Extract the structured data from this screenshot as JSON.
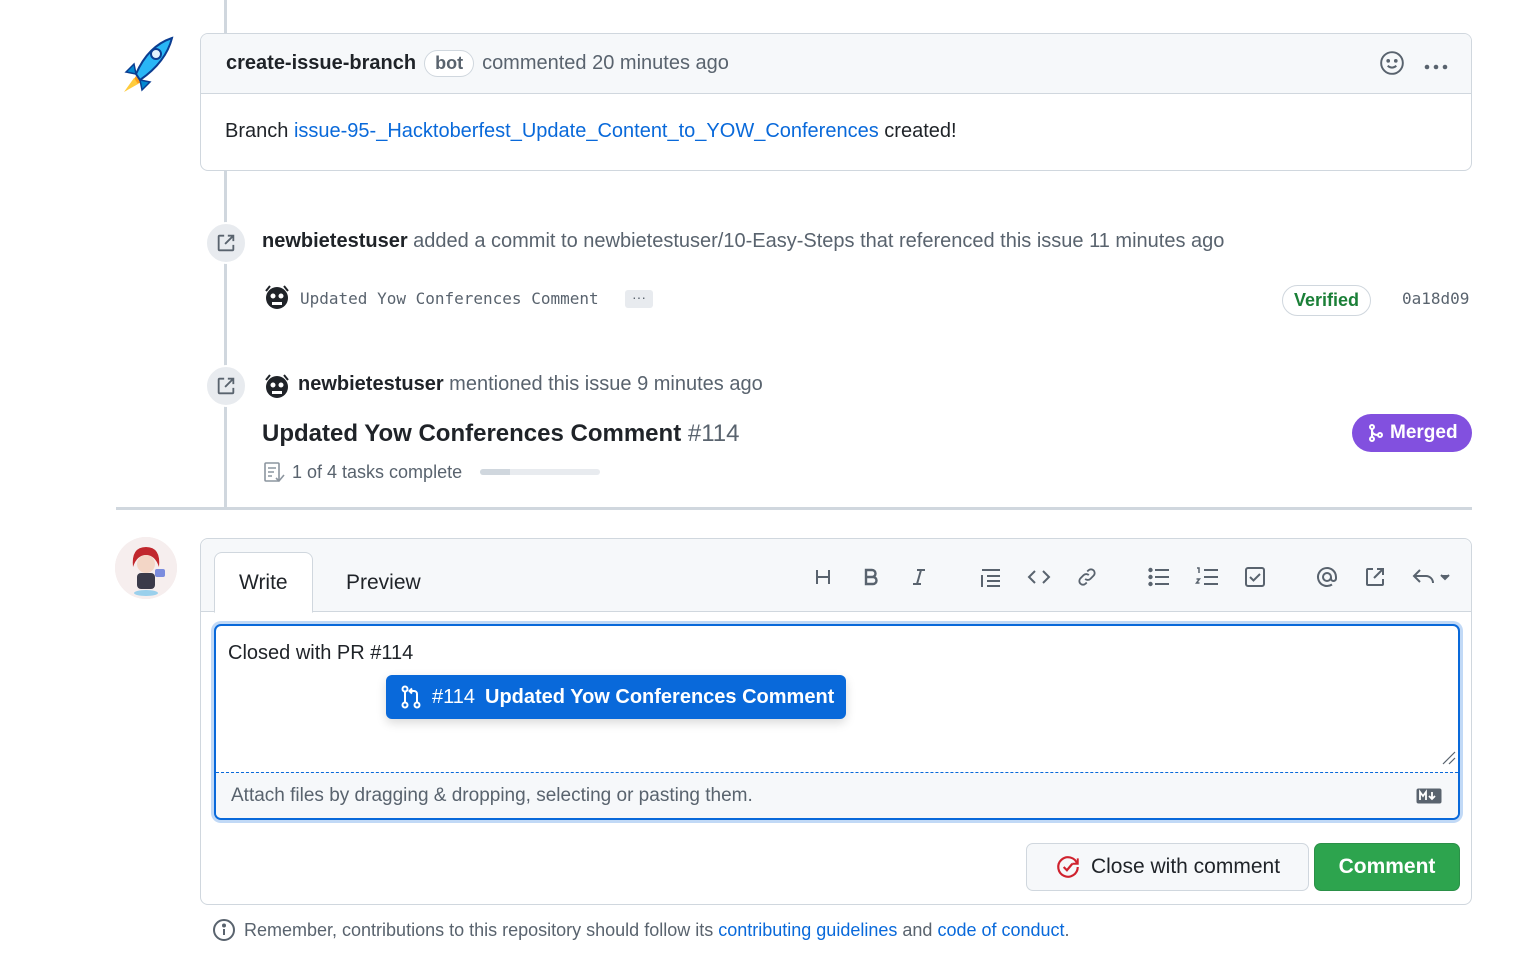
{
  "bot_comment": {
    "author": "create-issue-branch",
    "badge": "bot",
    "action": "commented",
    "time": "20 minutes ago",
    "body_prefix": "Branch",
    "branch_link": "issue-95-_Hacktoberfest_Update_Content_to_YOW_Conferences",
    "body_suffix": "created!"
  },
  "commit_event": {
    "author": "newbietestuser",
    "text": "added a commit to newbietestuser/10-Easy-Steps that referenced this issue",
    "time": "11 minutes ago",
    "commit_message": "Updated Yow Conferences Comment",
    "ellipsis": "···",
    "verified": "Verified",
    "sha": "0a18d09"
  },
  "mention_event": {
    "author": "newbietestuser",
    "text": "mentioned this issue",
    "time": "9 minutes ago",
    "pr_title": "Updated Yow Conferences Comment",
    "pr_number": "#114",
    "status": "Merged",
    "tasks": "1 of 4 tasks complete",
    "tasks_progress": 0.25
  },
  "composer": {
    "tabs": [
      "Write",
      "Preview"
    ],
    "toolbar_icons": [
      "heading-icon",
      "bold-icon",
      "italic-icon",
      "quote-icon",
      "code-icon",
      "link-icon",
      "unordered-list-icon",
      "ordered-list-icon",
      "task-list-icon",
      "mention-icon",
      "reference-icon",
      "reply-icon"
    ],
    "text": "Closed with PR #114",
    "suggestion_number": "#114",
    "suggestion_title": "Updated Yow Conferences Comment",
    "attach_hint": "Attach files by dragging & dropping, selecting or pasting them.",
    "close_button": "Close with comment",
    "comment_button": "Comment"
  },
  "footer_note": {
    "prefix": "Remember, contributions to this repository should follow its",
    "link1": "contributing guidelines",
    "middle": "and",
    "link2": "code of conduct",
    "suffix": "."
  },
  "colors": {
    "link": "#0969da",
    "merged": "#8250df",
    "verified": "#1a7f37",
    "comment_button": "#2da44e",
    "close_icon": "#cf222e"
  }
}
